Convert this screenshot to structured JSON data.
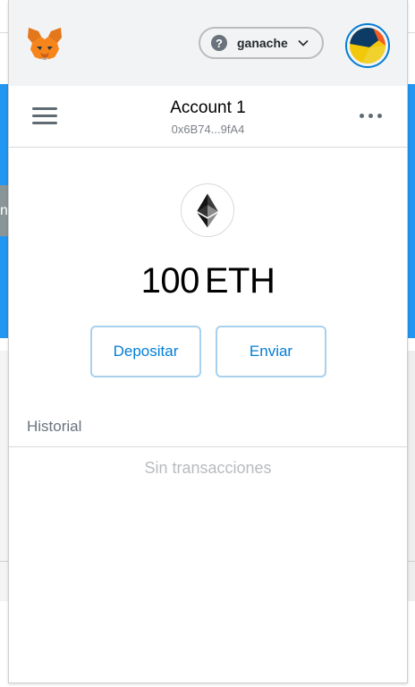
{
  "header": {
    "network": {
      "name": "ganache",
      "help_glyph": "?"
    },
    "logo": "metamask-fox-icon",
    "avatar": "account-identicon"
  },
  "account": {
    "name": "Account 1",
    "address": "0x6B74...9fA4"
  },
  "balance": {
    "amount": "100",
    "unit": "ETH"
  },
  "actions": {
    "deposit_label": "Depositar",
    "send_label": "Enviar"
  },
  "history": {
    "label": "Historial",
    "empty_text": "Sin transacciones"
  },
  "background": {
    "side_letter": "n"
  },
  "colors": {
    "accent": "#037dd6",
    "header_bg": "#f2f3f4",
    "button_border": "#a9d0ec",
    "page_blue": "#2196f3"
  }
}
